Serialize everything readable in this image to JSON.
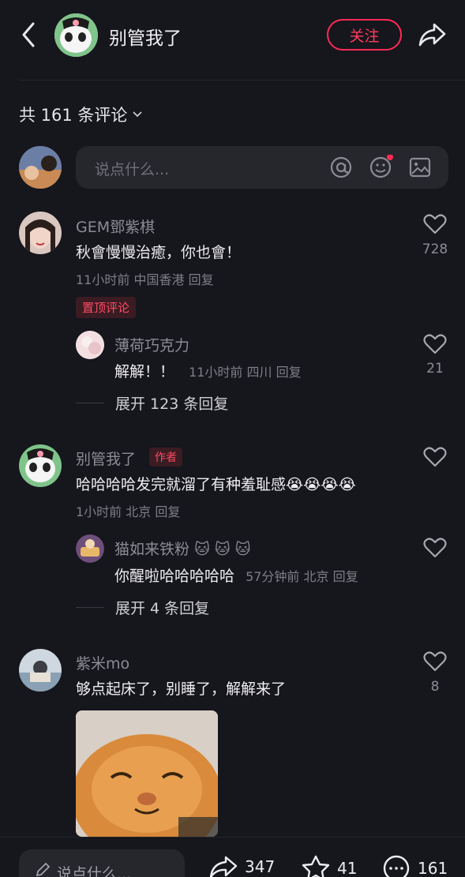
{
  "header": {
    "username": "别管我了",
    "follow_label": "关注"
  },
  "comments_header": {
    "count_text": "共 161 条评论"
  },
  "input": {
    "placeholder": "说点什么..."
  },
  "comments": [
    {
      "username": "GEM鄧紫棋",
      "text": "秋會慢慢治癒，你也會！",
      "time": "11小时前",
      "location": "中国香港",
      "reply_label": "回复",
      "likes": "728",
      "badge": "置顶评论",
      "sub_reply": {
        "username": "薄荷巧克力",
        "text": "解解！！",
        "time": "11小时前",
        "location": "四川",
        "reply_label": "回复",
        "likes": "21"
      },
      "expand_text": "展开 123 条回复"
    },
    {
      "username": "别管我了",
      "author_badge": "作者",
      "text": "哈哈哈哈发完就溜了有种羞耻感",
      "emojis": "😭😭😭😭",
      "time": "1小时前",
      "location": "北京",
      "reply_label": "回复",
      "likes": "",
      "sub_reply": {
        "username": "猫如来铁粉",
        "username_emojis": "🐱 🐱 🐱",
        "text": "你醒啦哈哈哈哈哈",
        "time": "57分钟前",
        "location": "北京",
        "reply_label": "回复"
      },
      "expand_text": "展开 4 条回复"
    },
    {
      "username": "紫米mo",
      "text": "够点起床了，别睡了，解解来了",
      "likes": "8"
    }
  ],
  "bottom_bar": {
    "placeholder": "说点什么...",
    "shares": "347",
    "favorites": "41",
    "comments": "161"
  }
}
